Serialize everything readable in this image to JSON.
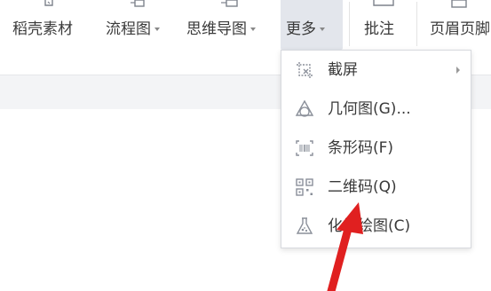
{
  "ribbon": {
    "items": [
      {
        "label": "稻壳素材",
        "icon": "daoke-materials-icon"
      },
      {
        "label": "流程图",
        "icon": "flowchart-icon",
        "dropdown": true
      },
      {
        "label": "思维导图",
        "icon": "mindmap-icon",
        "dropdown": true
      },
      {
        "label": "更多",
        "icon": "more-icon",
        "dropdown": true,
        "active": true
      },
      {
        "label": "批注",
        "icon": "comment-icon"
      },
      {
        "label": "页眉页脚",
        "icon": "header-footer-icon"
      }
    ]
  },
  "menu": {
    "items": [
      {
        "label": "截屏",
        "icon": "screenshot-icon",
        "submenu": true
      },
      {
        "label": "几何图(G)...",
        "icon": "geometry-icon"
      },
      {
        "label": "条形码(F)",
        "icon": "barcode-icon"
      },
      {
        "label": "二维码(Q)",
        "icon": "qrcode-icon"
      },
      {
        "label": "化学绘图(C)",
        "icon": "chemistry-flask-icon"
      }
    ]
  },
  "colors": {
    "accent_arrow": "#e02020",
    "menu_border": "#d7d9de",
    "active_bg": "#e3e6ec",
    "text": "#3a3a3a",
    "icon_gray": "#8a8f99"
  }
}
